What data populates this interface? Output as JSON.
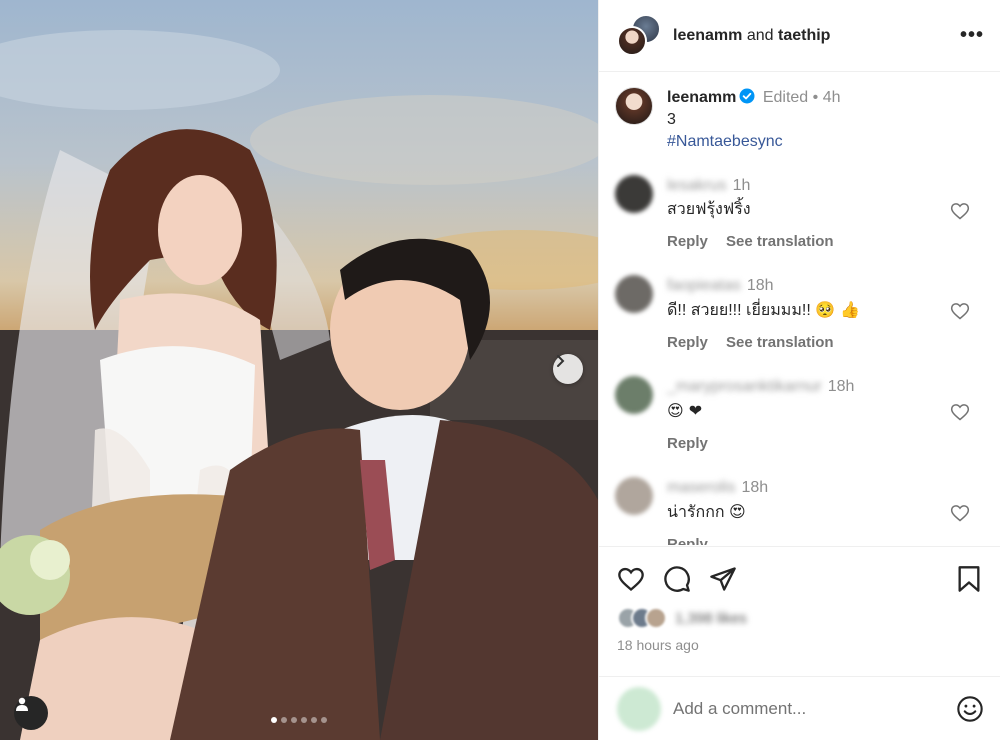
{
  "header": {
    "user1": "leenamm",
    "joiner": "and",
    "user2": "taethip",
    "more_label": "•••"
  },
  "caption": {
    "username": "leenamm",
    "edited": "Edited",
    "separator": "•",
    "time": "4h",
    "line1": "3",
    "hashtag": "#Namtaebesync"
  },
  "comments": [
    {
      "username": "lesakrus",
      "time": "1h",
      "text": "สวยฟรุ้งฟริ้ง",
      "reply": "Reply",
      "translate": "See translation"
    },
    {
      "username": "faopieatas",
      "time": "18h",
      "text": "ดี!! สวยย!!! เยี่ยมมม!!",
      "emojis": "🥺 👍",
      "reply": "Reply",
      "translate": "See translation"
    },
    {
      "username": "_maryprosanktikarnur",
      "time": "18h",
      "text": "",
      "emojis": "😍 ❤",
      "reply": "Reply"
    },
    {
      "username": "maserolis",
      "time": "18h",
      "text": "น่ารักกก",
      "emojis": "😍",
      "reply": "Reply"
    }
  ],
  "footer": {
    "likes": "1,398 likes",
    "posted": "18 hours ago"
  },
  "add_comment": {
    "placeholder": "Add a comment..."
  },
  "media": {
    "slides": 6,
    "active_slide": 1
  },
  "colors": {
    "verified": "#0095f6",
    "link": "#385898",
    "heart_red": "#ed4956"
  }
}
